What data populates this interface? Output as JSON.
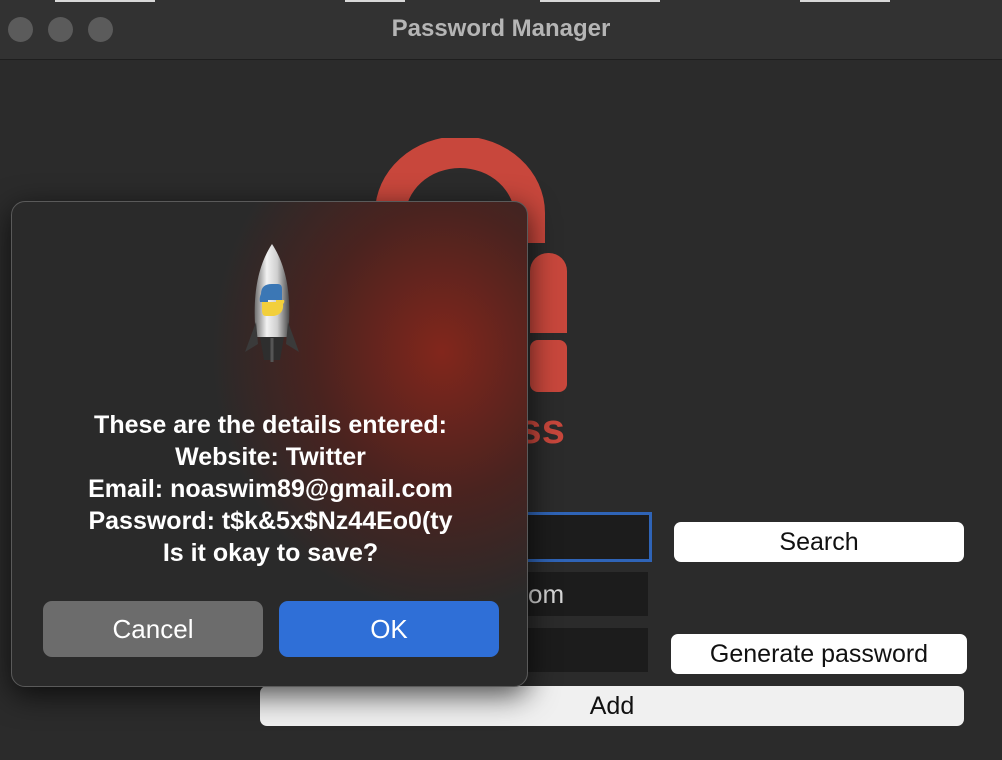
{
  "window": {
    "title": "Password Manager"
  },
  "form": {
    "website_value": "",
    "email_value": "om",
    "password_value": "",
    "search_label": "Search",
    "generate_label": "Generate password",
    "add_label": "Add"
  },
  "logo": {
    "partial_text": "ss",
    "color": "#c8473c"
  },
  "dialog": {
    "lines": [
      "These are the details entered:",
      "Website: Twitter",
      "Email: noaswim89@gmail.com",
      "Password: t$k&5x$Nz44Eo0(ty",
      "Is it okay to save?"
    ],
    "cancel_label": "Cancel",
    "ok_label": "OK",
    "ok_color": "#2f6fd7"
  }
}
